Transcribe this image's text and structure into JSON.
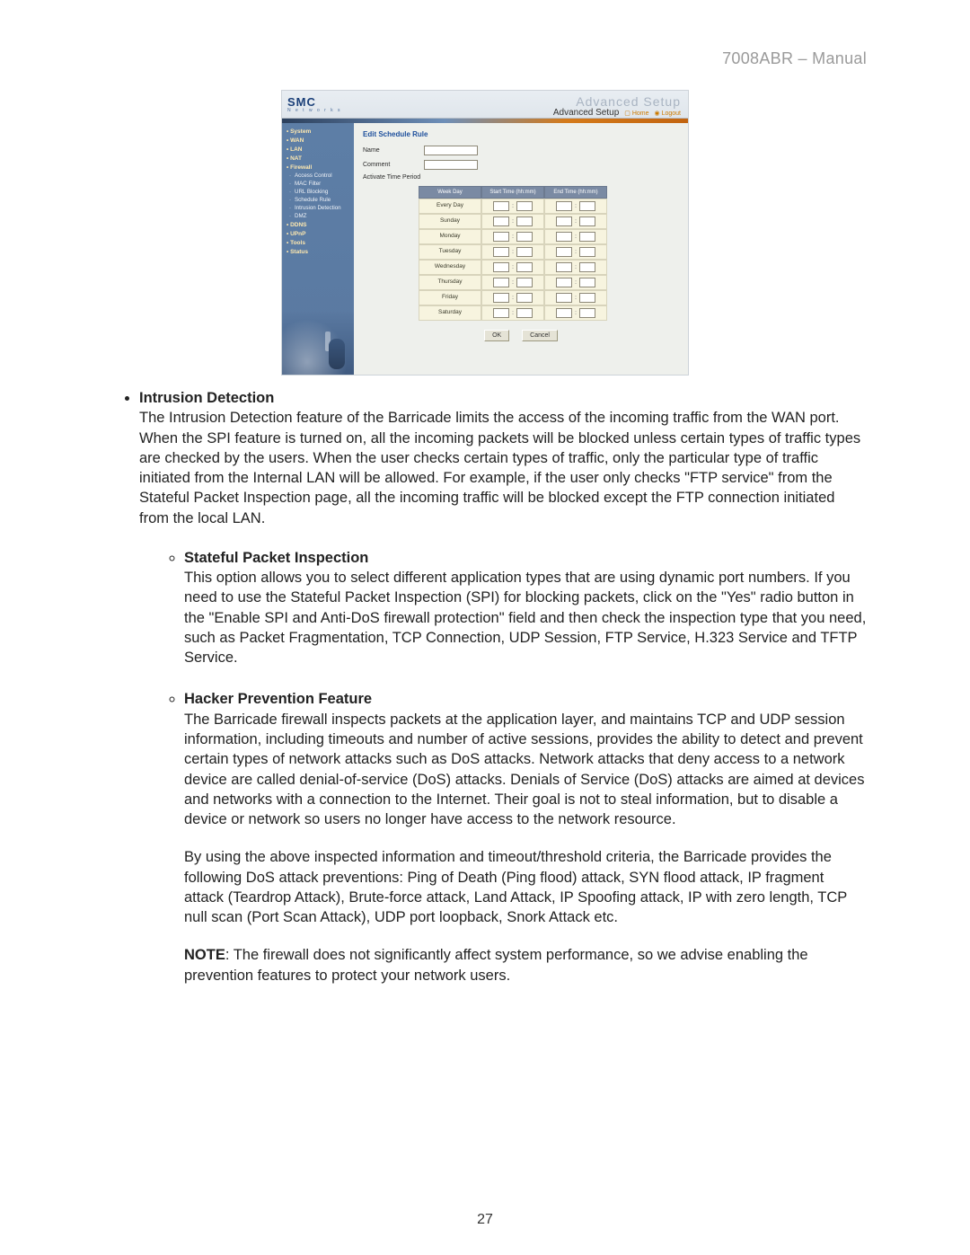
{
  "header_title": "7008ABR – Manual",
  "page_number": "27",
  "screenshot": {
    "logo": {
      "main": "SMC",
      "sub": "N e t w o r k s"
    },
    "ghost_title": "Advanced Setup",
    "advanced_label": "Advanced Setup",
    "home_link": "Home",
    "logout_link": "Logout",
    "sidebar_groups": [
      "System",
      "WAN",
      "LAN",
      "NAT",
      "Firewall"
    ],
    "sidebar_firewall_children": [
      "Access Control",
      "MAC Filter",
      "URL Blocking",
      "Schedule Rule",
      "Intrusion Detection",
      "DMZ"
    ],
    "sidebar_groups_tail": [
      "DDNS",
      "UPnP",
      "Tools",
      "Status"
    ],
    "form_title": "Edit Schedule Rule",
    "name_label": "Name",
    "comment_label": "Comment",
    "activate_label": "Activate Time Period",
    "table_headers": [
      "Week Day",
      "Start Time (hh:mm)",
      "End Time (hh:mm)"
    ],
    "days": [
      "Every Day",
      "Sunday",
      "Monday",
      "Tuesday",
      "Wednesday",
      "Thursday",
      "Friday",
      "Saturday"
    ],
    "ok_label": "OK",
    "cancel_label": "Cancel"
  },
  "body": {
    "intrusion_title": "Intrusion Detection",
    "intrusion_text": "The Intrusion Detection feature of the Barricade limits the access of the incoming traffic from the WAN port. When the SPI feature is turned on, all the incoming packets will be blocked unless certain types of traffic types are checked by the users. When the user checks certain types of traffic, only the particular type of traffic initiated from the Internal LAN will be allowed. For example, if the user only checks \"FTP service\" from the Stateful Packet Inspection page, all the incoming traffic will be blocked except the FTP connection initiated from the local LAN.",
    "spi_title": "Stateful Packet Inspection",
    "spi_text": "This option allows you to select different application types that are using dynamic port numbers. If you need to use the Stateful Packet Inspection (SPI) for blocking packets, click on the \"Yes\" radio button in the \"Enable SPI and Anti-DoS firewall protection\" field and then check the inspection type that you need, such as Packet Fragmentation, TCP Connection, UDP Session, FTP Service, H.323 Service and TFTP Service.",
    "hacker_title": "Hacker Prevention Feature",
    "hacker_p1": "The Barricade firewall inspects packets at the application layer, and maintains TCP and UDP session information, including timeouts and number of active sessions, provides the ability to detect and prevent certain types of network attacks such as DoS attacks. Network attacks that deny access to a network device are called denial-of-service (DoS) attacks. Denials of Service (DoS) attacks are aimed at devices and networks with a connection to the Internet. Their goal is not to steal information, but to disable a device or network so users no longer have access to the network resource.",
    "hacker_p2": "By using the above inspected information and timeout/threshold criteria, the Barricade provides the following DoS attack preventions: Ping of Death (Ping flood) attack, SYN flood attack, IP fragment attack (Teardrop Attack), Brute-force attack, Land Attack, IP Spoofing attack, IP with zero length, TCP null scan (Port Scan Attack), UDP port loopback, Snork Attack etc.",
    "note_lead": "NOTE",
    "note_text": ": The firewall does not significantly affect system performance, so we advise enabling the prevention features to protect your network users."
  }
}
